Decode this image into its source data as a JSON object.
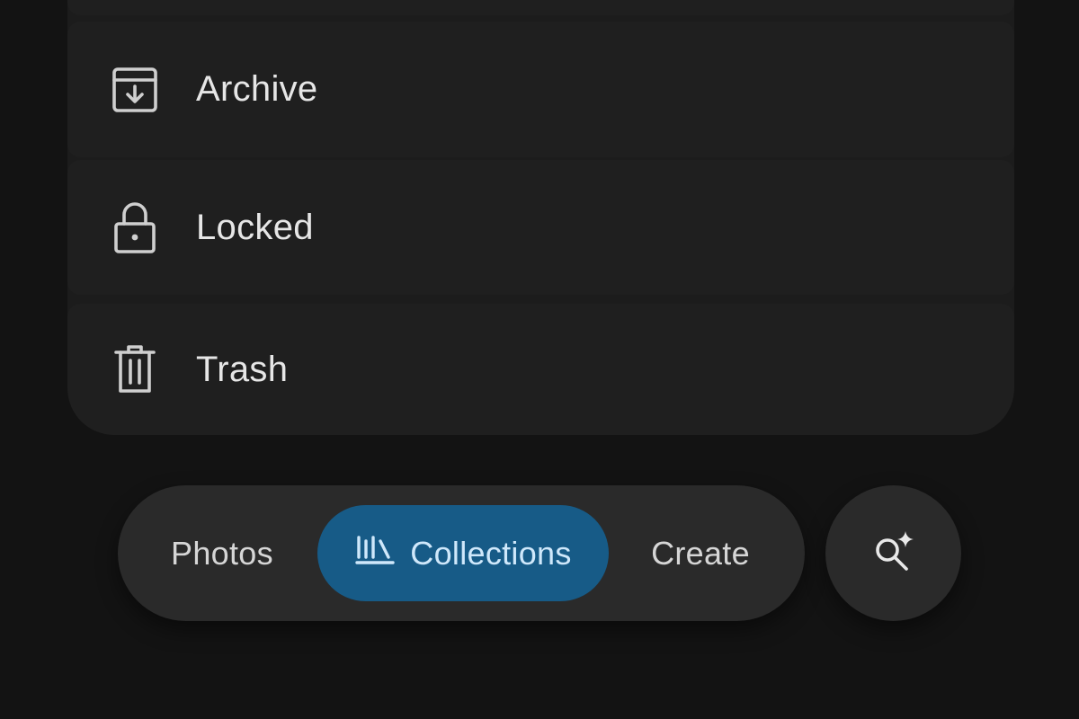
{
  "utility_list": {
    "items": [
      {
        "label": "Archive",
        "icon": "archive-icon"
      },
      {
        "label": "Locked",
        "icon": "lock-icon"
      },
      {
        "label": "Trash",
        "icon": "trash-icon"
      }
    ]
  },
  "bottom_nav": {
    "photos_label": "Photos",
    "collections_label": "Collections",
    "collections_icon": "collections-icon",
    "create_label": "Create",
    "active_tab": "Collections",
    "active_color": "#175b87"
  },
  "search_fab": {
    "icon": "search-sparkle-icon"
  },
  "colors": {
    "background": "#131313",
    "card": "#1f1f1f",
    "nav_surface": "#2a2a2a",
    "text": "#e6e6e6",
    "active_text": "#cfe8fb"
  }
}
